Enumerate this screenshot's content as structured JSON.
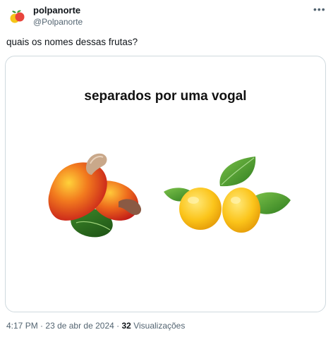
{
  "tweet": {
    "author_name": "polpanorte",
    "author_handle": "@Polpanorte",
    "text": "quais os nomes dessas frutas?",
    "more_label": "•••",
    "image_heading": "separados por uma vogal",
    "time": "4:17 PM",
    "separator": "·",
    "date": "23 de abr de 2024",
    "views_count": "32",
    "views_label": "Visualizações"
  },
  "icons": {
    "avatar": "fruit-logo-icon",
    "more": "more-options-icon"
  },
  "colors": {
    "text": "#0f1419",
    "secondary": "#536471",
    "border": "#cfd9de"
  }
}
